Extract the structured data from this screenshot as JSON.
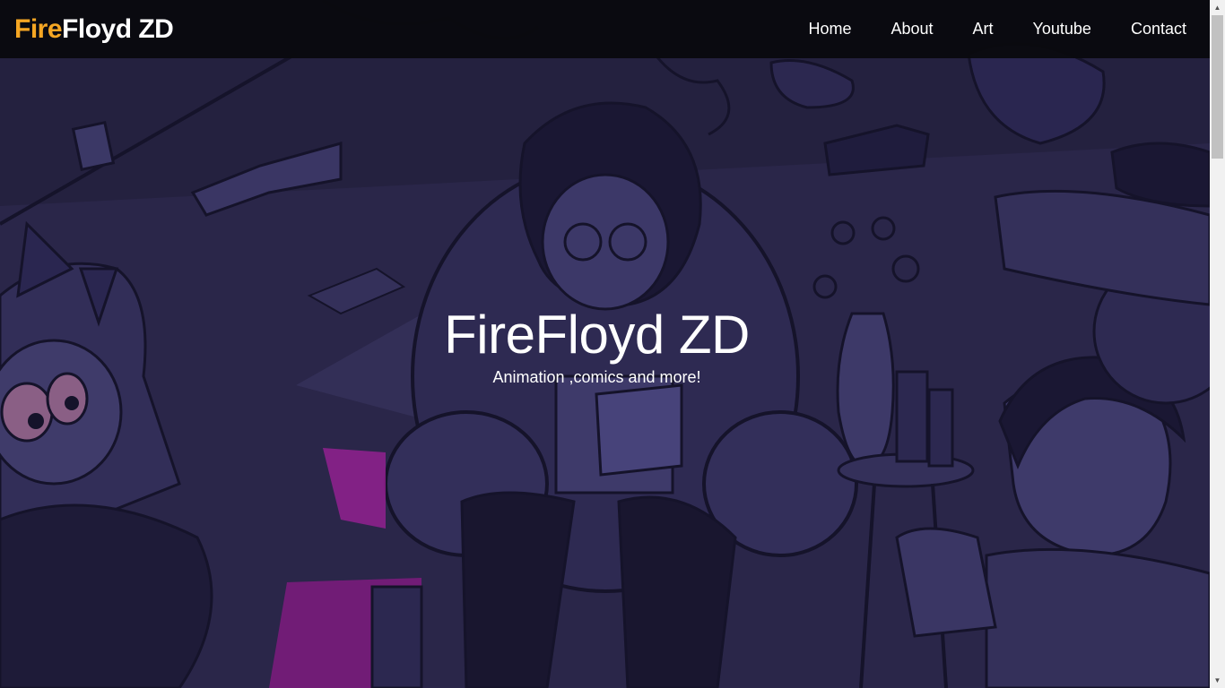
{
  "brand": {
    "part1": "Fire",
    "part2": "Floyd ZD"
  },
  "nav": {
    "items": [
      {
        "label": "Home"
      },
      {
        "label": "About"
      },
      {
        "label": "Art"
      },
      {
        "label": "Youtube"
      },
      {
        "label": "Contact"
      }
    ]
  },
  "hero": {
    "title": "FireFloyd ZD",
    "subtitle": "Animation ,comics and more!"
  },
  "colors": {
    "brand_accent": "#f5a623",
    "hero_overlay": "#24213f",
    "navbar_bg": "#0a0a0e",
    "highlight_magenta": "#a0209a"
  }
}
